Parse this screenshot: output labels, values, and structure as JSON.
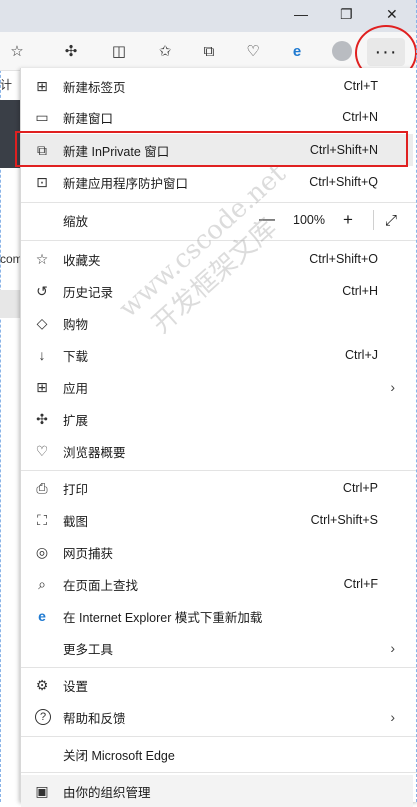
{
  "window": {
    "minimize_glyph": "—",
    "restore_glyph": "❐",
    "close_glyph": "✕"
  },
  "toolbar": {
    "more_glyph": "···"
  },
  "behind": {
    "text_top": "计",
    "text_com": "com"
  },
  "menu": {
    "items": [
      {
        "label": "新建标签页",
        "shortcut": "Ctrl+T",
        "icon": "new-tab-icon",
        "glyph": "⊞"
      },
      {
        "label": "新建窗口",
        "shortcut": "Ctrl+N",
        "icon": "new-window-icon",
        "glyph": "▭"
      },
      {
        "label": "新建 InPrivate 窗口",
        "shortcut": "Ctrl+Shift+N",
        "icon": "inprivate-icon",
        "glyph": "⧉"
      },
      {
        "label": "新建应用程序防护窗口",
        "shortcut": "Ctrl+Shift+Q",
        "icon": "app-guard-icon",
        "glyph": "⊡"
      },
      {
        "label": "缩放",
        "zoom_value": "100%",
        "minus": "—",
        "plus": "+",
        "fullscreen": "⤢"
      },
      {
        "label": "收藏夹",
        "shortcut": "Ctrl+Shift+O",
        "icon": "favorites-icon",
        "glyph": "☆"
      },
      {
        "label": "历史记录",
        "shortcut": "Ctrl+H",
        "icon": "history-icon",
        "glyph": "↺"
      },
      {
        "label": "购物",
        "shortcut": "",
        "icon": "shopping-tag-icon",
        "glyph": "◇"
      },
      {
        "label": "下载",
        "shortcut": "Ctrl+J",
        "icon": "download-icon",
        "glyph": "↓"
      },
      {
        "label": "应用",
        "shortcut": "",
        "icon": "apps-icon",
        "glyph": "⊞",
        "arrow": "›"
      },
      {
        "label": "扩展",
        "shortcut": "",
        "icon": "extensions-icon",
        "glyph": "✣"
      },
      {
        "label": "浏览器概要",
        "shortcut": "",
        "icon": "browser-essentials-icon",
        "glyph": "♡"
      },
      {
        "label": "打印",
        "shortcut": "Ctrl+P",
        "icon": "print-icon",
        "glyph": "⎙"
      },
      {
        "label": "截图",
        "shortcut": "Ctrl+Shift+S",
        "icon": "screenshot-icon",
        "glyph": "⛶"
      },
      {
        "label": "网页捕获",
        "shortcut": "",
        "icon": "web-capture-icon",
        "glyph": "◎"
      },
      {
        "label": "在页面上查找",
        "shortcut": "Ctrl+F",
        "icon": "find-icon",
        "glyph": "⌕"
      },
      {
        "label": "在 Internet Explorer 模式下重新加载",
        "shortcut": "",
        "icon": "ie-icon",
        "glyph": "e"
      },
      {
        "label": "更多工具",
        "shortcut": "",
        "arrow": "›"
      },
      {
        "label": "设置",
        "shortcut": "",
        "icon": "settings-gear-icon",
        "glyph": "⚙"
      },
      {
        "label": "帮助和反馈",
        "shortcut": "",
        "icon": "help-icon",
        "glyph": "?",
        "arrow": "›"
      },
      {
        "label": "关闭 Microsoft Edge",
        "shortcut": ""
      },
      {
        "label": "由你的组织管理",
        "shortcut": "",
        "icon": "managed-org-icon",
        "glyph": "▣"
      }
    ]
  },
  "watermark": {
    "line1": "www.cscode.net",
    "line2": "开发框架文库"
  }
}
